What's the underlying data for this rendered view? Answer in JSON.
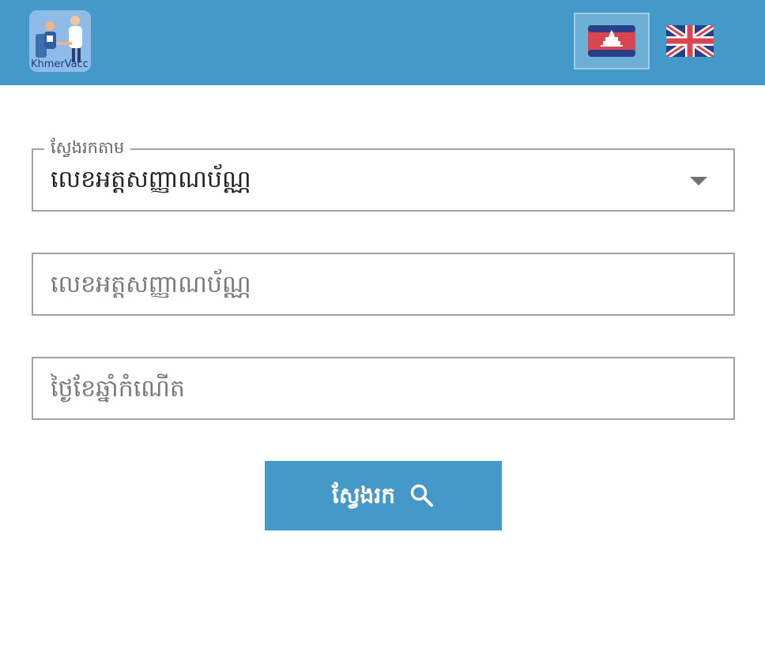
{
  "app": {
    "logo_text": "KhmerVacc"
  },
  "header": {
    "languages": [
      {
        "code": "km",
        "icon": "cambodia-flag-icon",
        "selected": true
      },
      {
        "code": "en",
        "icon": "uk-flag-icon",
        "selected": false
      }
    ],
    "accent_color": "#4499c9"
  },
  "form": {
    "search_by": {
      "label": "ស្វែងរកតាម",
      "selected": "លេខអត្តសញ្ញាណប័ណ្ណ",
      "icon": "caret-down-icon"
    },
    "id_number": {
      "placeholder": "លេខអត្តសញ្ញាណប័ណ្ណ",
      "value": ""
    },
    "date_of_birth": {
      "placeholder": "ថ្ងៃខែឆ្នាំកំណើត",
      "value": ""
    },
    "submit": {
      "label": "ស្វែងរក",
      "icon": "search-icon"
    }
  }
}
